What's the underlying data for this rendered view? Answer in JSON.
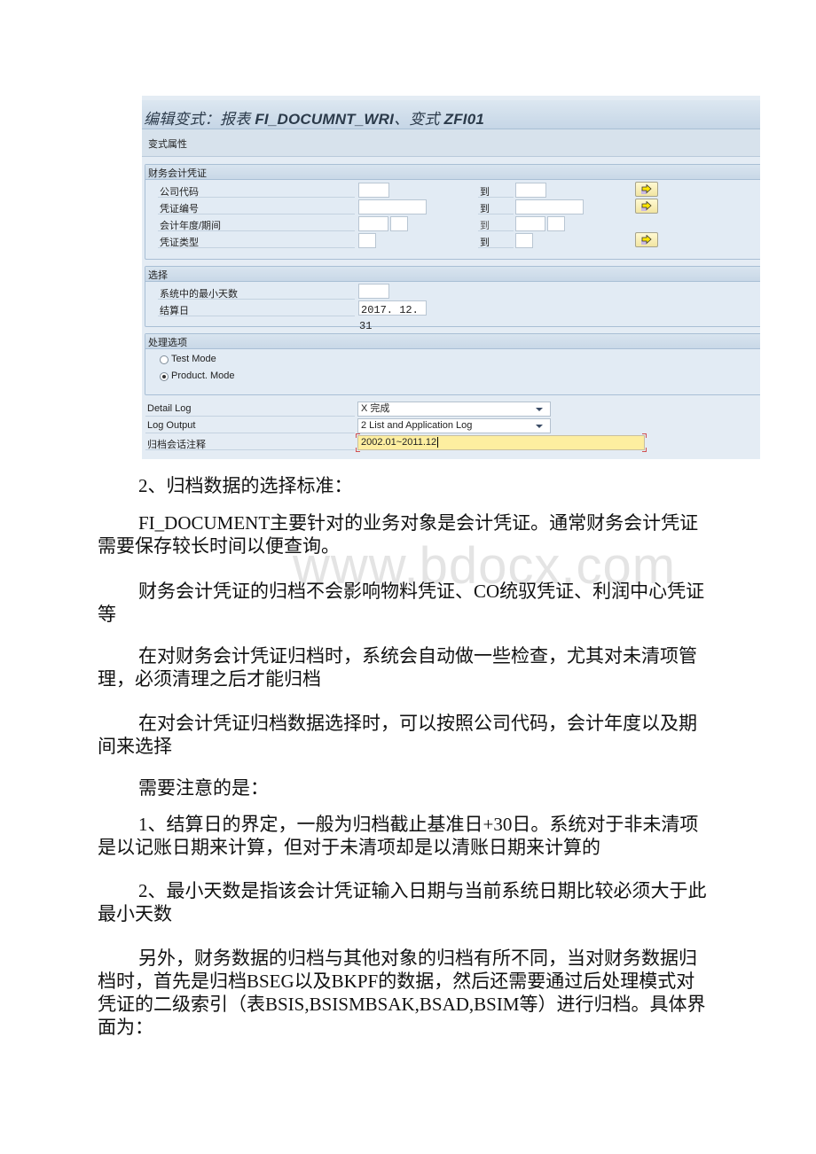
{
  "sap": {
    "title_prefix": "编辑变式：报表 ",
    "title_report": "FI_DOCUMNT_WRI",
    "title_mid": "、变式 ",
    "title_variant": "ZFI01",
    "toolbar_label": "变式属性",
    "group_documents": {
      "header": "财务会计凭证",
      "rows": [
        {
          "label": "公司代码",
          "to": "到",
          "from_value": "",
          "to_value": "",
          "has_multi": true
        },
        {
          "label": "凭证编号",
          "to": "到",
          "from_value": "",
          "to_value": "",
          "has_multi": true
        },
        {
          "label": "会计年度/期间",
          "to": "到",
          "from_value": "",
          "to_value": "",
          "has_multi": false
        },
        {
          "label": "凭证类型",
          "to": "到",
          "from_value": "",
          "to_value": "",
          "has_multi": true
        }
      ]
    },
    "group_selection": {
      "header": "选择",
      "min_days_label": "系统中的最小天数",
      "min_days_value": "",
      "key_date_label": "结算日",
      "key_date_value": "2017. 12. 31"
    },
    "group_processing": {
      "header": "处理选项",
      "options": [
        {
          "label": "Test Mode",
          "selected": false
        },
        {
          "label": "Product. Mode",
          "selected": true
        }
      ]
    },
    "detail_log": {
      "label": "Detail Log",
      "value": "X 完成"
    },
    "log_output": {
      "label": "Log Output",
      "value": "2 List and Application Log"
    },
    "archive_note": {
      "label": "归档会话注释",
      "value": "2002.01~2011.12"
    }
  },
  "doc": {
    "heading": "2、归档数据的选择标准：",
    "paragraphs": [
      "FI_DOCUMENT主要针对的业务对象是会计凭证。通常财务会计凭证需要保存较长时间以便查询。",
      "财务会计凭证的归档不会影响物料凭证、CO统驭凭证、利润中心凭证等",
      "在对财务会计凭证归档时，系统会自动做一些检查，尤其对未清项管理，必须清理之后才能归档",
      "在对会计凭证归档数据选择时，可以按照公司代码，会计年度以及期间来选择",
      "需要注意的是：",
      "1、结算日的界定，一般为归档截止基准日+30日。系统对于非未清项是以记账日期来计算，但对于未清项却是以清账日期来计算的",
      "2、最小天数是指该会计凭证输入日期与当前系统日期比较必须大于此最小天数",
      "另外，财务数据的归档与其他对象的归档有所不同，当对财务数据归档时，首先是归档BSEG以及BKPF的数据，然后还需要通过后处理模式对凭证的二级索引（表BSIS,BSISMBSAK,BSAD,BSIM等）进行归档。具体界面为："
    ],
    "watermark": "www.bdocx.com"
  }
}
